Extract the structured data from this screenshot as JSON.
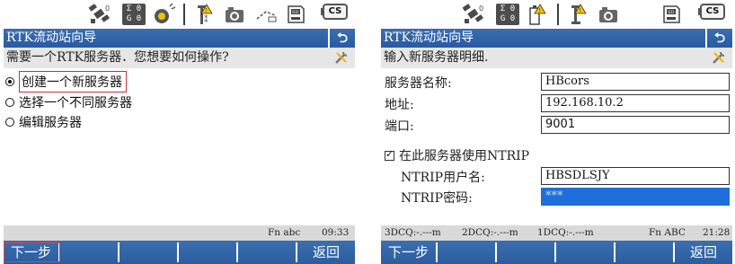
{
  "left": {
    "title": "RTK流动站向导",
    "prompt": "需要一个RTK服务器．您想要如何操作?",
    "gps_box": [
      "Σ 0",
      "G 0"
    ],
    "cs_label": "CS",
    "options": [
      {
        "label": "创建一个新服务器",
        "selected": true
      },
      {
        "label": "选择一个不同服务器",
        "selected": false
      },
      {
        "label": "编辑服务器",
        "selected": false
      }
    ],
    "info": {
      "mode": "Fn  abc",
      "time": "09:33"
    },
    "softkeys": {
      "next": "下一步",
      "back": "返回"
    }
  },
  "right": {
    "title": "RTK流动站向导",
    "prompt": "输入新服务器明细.",
    "gps_box": [
      "Σ 0",
      "G 0"
    ],
    "cs_label": "CS",
    "fields": {
      "server_name_label": "服务器名称:",
      "server_name_value": "HBcors",
      "address_label": "地址:",
      "address_value": "192.168.10.2",
      "port_label": "端口:",
      "port_value": "9001"
    },
    "ntrip_checkbox": {
      "label": "在此服务器使用NTRIP",
      "checked": true
    },
    "ntrip_user_label": "NTRIP用户名:",
    "ntrip_user_value": "HBSDLSJY",
    "ntrip_pass_label": "NTRIP密码:",
    "ntrip_pass_value": "***",
    "info": {
      "dcq3": "3DCQ:-.---m",
      "dcq2": "2DCQ:-.---m",
      "dcq1": "1DCQ:-.---m",
      "mode": "Fn  ABC",
      "time": "21:28"
    },
    "softkeys": {
      "next": "下一步",
      "back": "返回"
    }
  },
  "colors": {
    "title_bar": "#2f63a6",
    "highlight": "#1e6fd9",
    "selection_border": "#c83232"
  }
}
